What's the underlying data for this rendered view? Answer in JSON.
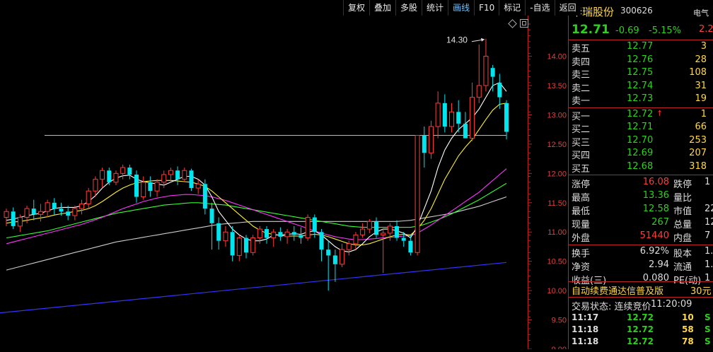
{
  "toolbar": {
    "buttons": [
      {
        "label": "复权",
        "active": false
      },
      {
        "label": "叠加",
        "active": false
      },
      {
        "label": "多股",
        "active": false
      },
      {
        "label": "统计",
        "active": false
      },
      {
        "label": "画线",
        "active": true
      },
      {
        "label": "F10",
        "active": false
      },
      {
        "label": "标记",
        "active": false
      },
      {
        "label": "-自选",
        "active": false
      },
      {
        "label": "返回",
        "active": false
      }
    ]
  },
  "chart": {
    "high_label": "14.30",
    "ylim": [
      9.0,
      14.55
    ],
    "yticks": [
      {
        "label": "14.00",
        "value": 14.0
      },
      {
        "label": "13.50",
        "value": 13.5
      },
      {
        "label": "13.00",
        "value": 13.0
      },
      {
        "label": "12.50",
        "value": 12.5
      },
      {
        "label": "12.00",
        "value": 12.0
      },
      {
        "label": "11.50",
        "value": 11.5
      },
      {
        "label": "11.00",
        "value": 11.0
      },
      {
        "label": "10.50",
        "value": 10.5
      },
      {
        "label": "10.00",
        "value": 10.0
      },
      {
        "label": "9.50",
        "value": 9.5
      },
      {
        "label": "9.00",
        "value": 9.0
      }
    ],
    "colors": {
      "up": "#ff3b3b",
      "down": "#00e5ee",
      "ma5": "#ffffff",
      "ma10": "#ffee33",
      "ma20": "#ff33ff",
      "ma30": "#33ff33",
      "ma60": "#cccccc",
      "long": "#3333ff",
      "hline": "#cccc33"
    }
  },
  "chart_data": {
    "type": "candlestick",
    "hline": {
      "value": 12.65
    },
    "long_trend": {
      "from": 9.62,
      "to": 10.48
    },
    "candles": [
      [
        11.25,
        11.4,
        11.1,
        11.35
      ],
      [
        11.35,
        11.42,
        11.05,
        11.1
      ],
      [
        11.1,
        11.3,
        11.0,
        11.25
      ],
      [
        11.25,
        11.45,
        11.15,
        11.4
      ],
      [
        11.4,
        11.55,
        11.2,
        11.3
      ],
      [
        11.3,
        11.48,
        11.18,
        11.35
      ],
      [
        11.35,
        11.55,
        11.25,
        11.5
      ],
      [
        11.5,
        11.58,
        11.3,
        11.4
      ],
      [
        11.4,
        11.5,
        11.28,
        11.35
      ],
      [
        11.35,
        11.45,
        11.2,
        11.28
      ],
      [
        11.28,
        11.45,
        11.2,
        11.4
      ],
      [
        11.4,
        11.55,
        11.3,
        11.48
      ],
      [
        11.48,
        11.75,
        11.4,
        11.7
      ],
      [
        11.7,
        11.95,
        11.6,
        11.9
      ],
      [
        11.9,
        12.1,
        11.75,
        12.05
      ],
      [
        12.05,
        12.1,
        11.8,
        11.85
      ],
      [
        11.85,
        12.05,
        11.8,
        12.0
      ],
      [
        12.0,
        12.15,
        11.9,
        12.1
      ],
      [
        12.1,
        12.15,
        11.9,
        11.98
      ],
      [
        11.98,
        12.05,
        11.5,
        11.6
      ],
      [
        11.6,
        11.95,
        11.55,
        11.85
      ],
      [
        11.85,
        11.95,
        11.6,
        11.7
      ],
      [
        11.7,
        11.9,
        11.6,
        11.85
      ],
      [
        11.85,
        12.05,
        11.75,
        11.98
      ],
      [
        11.98,
        12.1,
        11.85,
        12.05
      ],
      [
        12.05,
        12.12,
        11.8,
        11.9
      ],
      [
        11.9,
        12.1,
        11.85,
        12.05
      ],
      [
        12.05,
        12.08,
        11.7,
        11.75
      ],
      [
        11.75,
        11.9,
        11.65,
        11.82
      ],
      [
        11.82,
        11.9,
        11.3,
        11.4
      ],
      [
        11.4,
        11.5,
        10.7,
        11.15
      ],
      [
        11.15,
        11.25,
        10.7,
        10.85
      ],
      [
        10.85,
        11.1,
        10.75,
        11.0
      ],
      [
        11.0,
        11.1,
        10.5,
        10.6
      ],
      [
        10.6,
        10.95,
        10.5,
        10.9
      ],
      [
        10.9,
        10.95,
        10.55,
        10.65
      ],
      [
        10.65,
        10.95,
        10.6,
        10.9
      ],
      [
        10.9,
        11.1,
        10.8,
        11.05
      ],
      [
        11.05,
        11.1,
        10.8,
        10.9
      ],
      [
        10.9,
        11.05,
        10.75,
        11.0
      ],
      [
        11.0,
        11.08,
        10.85,
        10.92
      ],
      [
        10.92,
        11.05,
        10.8,
        11.0
      ],
      [
        11.0,
        11.1,
        10.85,
        10.95
      ],
      [
        10.95,
        11.08,
        10.8,
        10.9
      ],
      [
        10.9,
        11.3,
        10.85,
        11.25
      ],
      [
        11.25,
        11.3,
        10.9,
        11.0
      ],
      [
        11.0,
        11.05,
        10.5,
        10.7
      ],
      [
        10.7,
        10.85,
        10.0,
        10.6
      ],
      [
        10.6,
        10.7,
        10.15,
        10.45
      ],
      [
        10.45,
        10.8,
        10.4,
        10.7
      ],
      [
        10.7,
        10.85,
        10.6,
        10.8
      ],
      [
        10.8,
        11.0,
        10.7,
        10.95
      ],
      [
        10.95,
        11.15,
        10.9,
        11.05
      ],
      [
        11.05,
        11.22,
        10.98,
        11.18
      ],
      [
        11.18,
        11.25,
        10.9,
        10.95
      ],
      [
        10.95,
        11.05,
        10.3,
        10.98
      ],
      [
        10.98,
        11.15,
        10.85,
        11.1
      ],
      [
        11.1,
        11.2,
        10.85,
        10.9
      ],
      [
        10.9,
        11.0,
        10.75,
        10.85
      ],
      [
        10.85,
        10.95,
        10.6,
        10.65
      ],
      [
        10.65,
        12.65,
        10.6,
        12.65
      ],
      [
        12.65,
        12.8,
        12.1,
        12.35
      ],
      [
        12.35,
        12.9,
        12.25,
        12.8
      ],
      [
        12.8,
        13.4,
        12.6,
        13.2
      ],
      [
        13.2,
        13.35,
        12.7,
        12.8
      ],
      [
        12.8,
        13.2,
        12.7,
        13.05
      ],
      [
        13.05,
        13.25,
        12.7,
        12.85
      ],
      [
        12.85,
        13.05,
        12.65,
        12.6
      ],
      [
        12.6,
        13.55,
        12.55,
        13.3
      ],
      [
        13.3,
        14.2,
        13.2,
        13.5
      ],
      [
        13.5,
        14.3,
        13.4,
        14.0
      ],
      [
        13.8,
        13.85,
        13.4,
        13.65
      ],
      [
        13.55,
        13.7,
        13.1,
        13.3
      ],
      [
        13.2,
        13.25,
        12.58,
        12.71
      ]
    ],
    "ma5": [
      11.2,
      11.22,
      11.25,
      11.28,
      11.3,
      11.32,
      11.36,
      11.4,
      11.42,
      11.42,
      11.42,
      11.45,
      11.52,
      11.62,
      11.75,
      11.85,
      11.92,
      11.96,
      11.97,
      11.9,
      11.86,
      11.84,
      11.82,
      11.8,
      11.85,
      11.9,
      11.95,
      11.95,
      11.9,
      11.8,
      11.6,
      11.35,
      11.2,
      11.05,
      10.95,
      10.88,
      10.85,
      10.85,
      10.88,
      10.95,
      10.95,
      10.96,
      10.97,
      10.96,
      11.0,
      11.02,
      10.95,
      10.85,
      10.75,
      10.68,
      10.66,
      10.7,
      10.8,
      10.92,
      11.0,
      11.05,
      11.05,
      11.02,
      10.98,
      10.9,
      11.1,
      11.4,
      11.7,
      12.1,
      12.4,
      12.6,
      12.75,
      12.85,
      12.95,
      13.1,
      13.3,
      13.5,
      13.55,
      13.4
    ],
    "ma10": [
      11.15,
      11.17,
      11.18,
      11.2,
      11.22,
      11.24,
      11.26,
      11.29,
      11.31,
      11.33,
      11.35,
      11.37,
      11.4,
      11.45,
      11.52,
      11.6,
      11.68,
      11.75,
      11.8,
      11.84,
      11.86,
      11.87,
      11.88,
      11.88,
      11.88,
      11.87,
      11.86,
      11.85,
      11.82,
      11.78,
      11.7,
      11.6,
      11.5,
      11.4,
      11.3,
      11.2,
      11.1,
      11.03,
      10.98,
      10.96,
      10.94,
      10.93,
      10.93,
      10.93,
      10.95,
      10.96,
      10.95,
      10.92,
      10.88,
      10.84,
      10.8,
      10.78,
      10.78,
      10.8,
      10.84,
      10.88,
      10.92,
      10.95,
      10.96,
      10.95,
      11.05,
      11.2,
      11.4,
      11.65,
      11.9,
      12.1,
      12.3,
      12.45,
      12.58,
      12.75,
      12.92,
      13.08,
      13.18,
      13.2
    ],
    "ma20": [
      10.8,
      10.83,
      10.86,
      10.89,
      10.92,
      10.95,
      10.98,
      11.01,
      11.04,
      11.07,
      11.1,
      11.13,
      11.17,
      11.21,
      11.25,
      11.3,
      11.35,
      11.4,
      11.44,
      11.48,
      11.52,
      11.55,
      11.58,
      11.6,
      11.62,
      11.63,
      11.64,
      11.64,
      11.63,
      11.62,
      11.6,
      11.57,
      11.54,
      11.5,
      11.46,
      11.42,
      11.38,
      11.34,
      11.3,
      11.26,
      11.22,
      11.18,
      11.14,
      11.1,
      11.06,
      11.02,
      10.98,
      10.95,
      10.92,
      10.9,
      10.88,
      10.87,
      10.87,
      10.88,
      10.89,
      10.9,
      10.91,
      10.92,
      10.93,
      10.94,
      10.98,
      11.05,
      11.12,
      11.2,
      11.28,
      11.36,
      11.44,
      11.52,
      11.6,
      11.68,
      11.78,
      11.88,
      11.98,
      12.08
    ],
    "ma30": [
      10.9,
      10.92,
      10.94,
      10.96,
      10.98,
      11.0,
      11.02,
      11.05,
      11.08,
      11.11,
      11.14,
      11.17,
      11.2,
      11.23,
      11.26,
      11.29,
      11.32,
      11.34,
      11.36,
      11.38,
      11.4,
      11.42,
      11.44,
      11.46,
      11.47,
      11.48,
      11.49,
      11.5,
      11.5,
      11.49,
      11.48,
      11.47,
      11.46,
      11.44,
      11.42,
      11.4,
      11.38,
      11.36,
      11.34,
      11.32,
      11.3,
      11.28,
      11.26,
      11.24,
      11.22,
      11.2,
      11.18,
      11.16,
      11.14,
      11.12,
      11.1,
      11.09,
      11.08,
      11.08,
      11.08,
      11.08,
      11.08,
      11.08,
      11.08,
      11.08,
      11.1,
      11.13,
      11.17,
      11.21,
      11.26,
      11.31,
      11.37,
      11.43,
      11.49,
      11.55,
      11.62,
      11.69,
      11.76,
      11.83
    ],
    "ma60": [
      10.35,
      10.38,
      10.41,
      10.44,
      10.47,
      10.5,
      10.53,
      10.56,
      10.59,
      10.62,
      10.65,
      10.68,
      10.71,
      10.74,
      10.77,
      10.8,
      10.83,
      10.85,
      10.87,
      10.89,
      10.91,
      10.93,
      10.95,
      10.97,
      10.99,
      11.01,
      11.03,
      11.05,
      11.07,
      11.09,
      11.11,
      11.13,
      11.14,
      11.15,
      11.16,
      11.17,
      11.18,
      11.18,
      11.18,
      11.18,
      11.18,
      11.18,
      11.18,
      11.18,
      11.18,
      11.18,
      11.18,
      11.18,
      11.18,
      11.18,
      11.18,
      11.18,
      11.18,
      11.18,
      11.18,
      11.18,
      11.18,
      11.18,
      11.19,
      11.2,
      11.22,
      11.24,
      11.26,
      11.28,
      11.3,
      11.32,
      11.35,
      11.38,
      11.41,
      11.44,
      11.48,
      11.52,
      11.56,
      11.6
    ]
  },
  "panel": {
    "stock_name": "华瑞股份",
    "stock_code": "300626",
    "tab_label": "电气",
    "price": "12.71",
    "change": "-0.69",
    "change_pct": "-5.15%",
    "side_value": "2.2",
    "asks": [
      {
        "label": "卖五",
        "price": "12.77",
        "vol": "3"
      },
      {
        "label": "卖四",
        "price": "12.76",
        "vol": "28"
      },
      {
        "label": "卖三",
        "price": "12.75",
        "vol": "108"
      },
      {
        "label": "卖二",
        "price": "12.74",
        "vol": "31"
      },
      {
        "label": "卖一",
        "price": "12.73",
        "vol": "19"
      }
    ],
    "bids": [
      {
        "label": "买一",
        "price": "12.72",
        "vol": "1",
        "arrow": "↑"
      },
      {
        "label": "买二",
        "price": "12.71",
        "vol": "66",
        "arrow": ""
      },
      {
        "label": "买三",
        "price": "12.70",
        "vol": "253",
        "arrow": ""
      },
      {
        "label": "买四",
        "price": "12.69",
        "vol": "207",
        "arrow": ""
      },
      {
        "label": "买五",
        "price": "12.68",
        "vol": "318",
        "arrow": ""
      }
    ],
    "stats": [
      {
        "label": "涨停",
        "value": "16.08",
        "color": "#ff3b3b",
        "label2": "跌停",
        "value2": "1"
      },
      {
        "label": "最高",
        "value": "13.36",
        "color": "#2dd11d",
        "label2": "量比",
        "value2": ""
      },
      {
        "label": "最低",
        "value": "12.58",
        "color": "#2dd11d",
        "label2": "市值",
        "value2": "22"
      },
      {
        "label": "现量",
        "value": "267",
        "color": "#2dd11d",
        "label2": "总量",
        "value2": "12"
      },
      {
        "label": "外盘",
        "value": "51440",
        "color": "#ff3b3b",
        "label2": "内盘",
        "value2": "7"
      }
    ],
    "stats2": [
      {
        "label": "换手",
        "value": "6.92%",
        "color": "#ddd",
        "label2": "股本",
        "value2": "1."
      },
      {
        "label": "净资",
        "value": "2.94",
        "color": "#ddd",
        "label2": "流通",
        "value2": "1."
      },
      {
        "label": "收益(三)",
        "value": "0.080",
        "color": "#ddd",
        "label2": "PE(动)",
        "value2": "1"
      }
    ],
    "ad_text": "自动续费通达信普及版",
    "ad_price": "30元",
    "trade_status": "交易状态: 连续竞价",
    "trade_time": "11:20:09",
    "ticks": [
      {
        "time": "11:17",
        "price": "12.72",
        "vol": "10",
        "dir": "S"
      },
      {
        "time": "11:18",
        "price": "12.72",
        "vol": "58",
        "dir": "S"
      },
      {
        "time": "11:18",
        "price": "12.72",
        "vol": "78",
        "dir": "S"
      }
    ]
  }
}
